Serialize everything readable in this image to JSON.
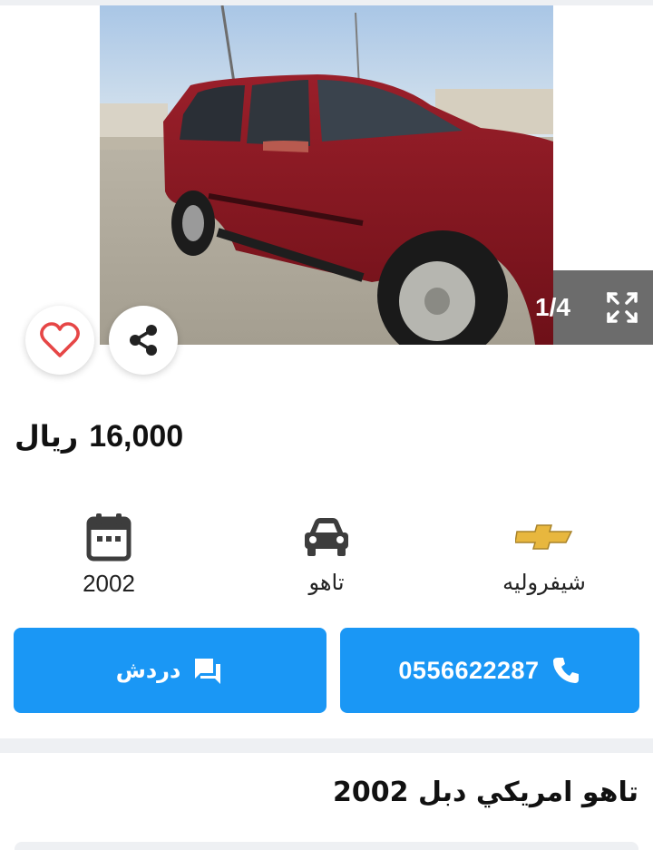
{
  "gallery": {
    "counter": "1/4",
    "icons": {
      "prev": "chevron-left-icon",
      "next": "chevron-right-icon",
      "expand": "fullscreen-icon",
      "favorite": "heart-outline-icon",
      "share": "share-icon"
    },
    "colors": {
      "heart": "#e64646",
      "counter_bg": "#6c6c6c"
    }
  },
  "price": {
    "value": "16,000",
    "currency": "ريال"
  },
  "specs": {
    "year": {
      "icon": "calendar-icon",
      "value": "2002"
    },
    "model": {
      "icon": "car-icon",
      "value": "تاهو"
    },
    "make": {
      "icon": "chevrolet-logo",
      "value": "شيفروليه"
    }
  },
  "actions": {
    "chat": {
      "label": "دردش",
      "icon": "chat-icon"
    },
    "call": {
      "label": "0556622287",
      "icon": "phone-icon"
    },
    "accent": "#1a97f5"
  },
  "listing": {
    "title": "تاهو امريكي دبل 2002"
  }
}
